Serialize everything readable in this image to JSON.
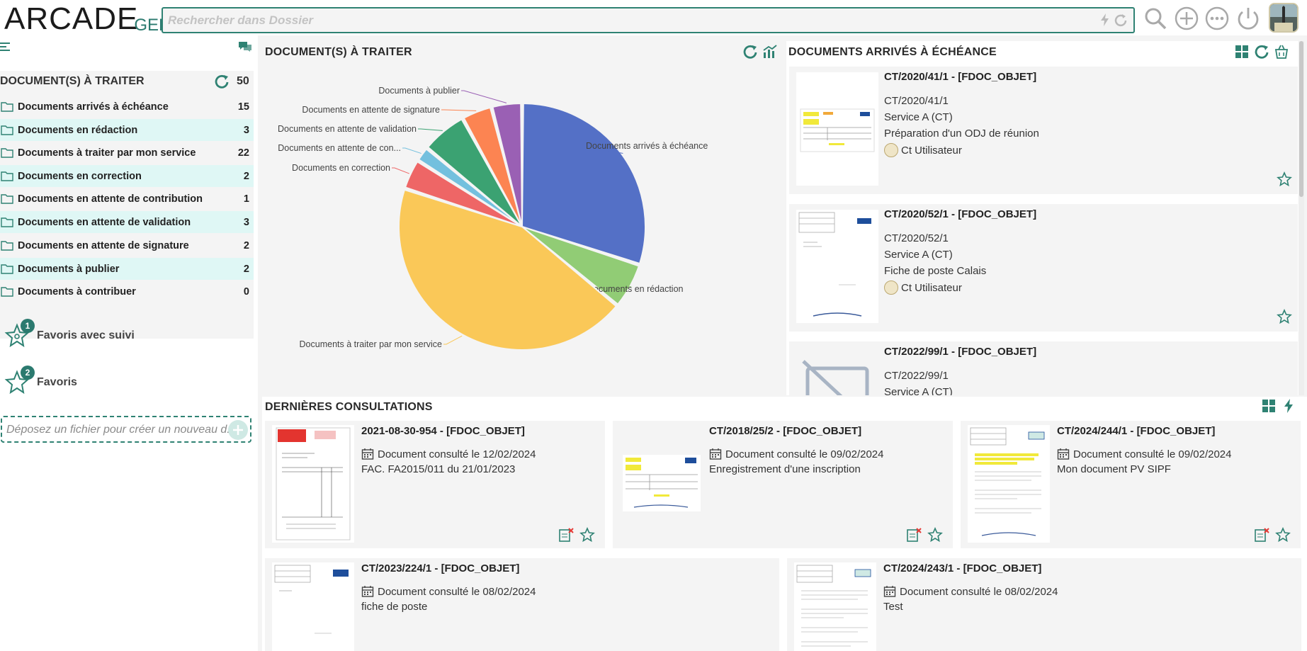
{
  "header": {
    "logo_main": "ARCADE",
    "logo_sub": "GED",
    "search_placeholder": "Rechercher dans Dossier",
    "icons": [
      "search-icon",
      "add-icon",
      "more-icon",
      "power-icon",
      "user-avatar"
    ]
  },
  "sidebar": {
    "queue": {
      "title": "DOCUMENT(S) À TRAITER",
      "total": "50",
      "items": [
        {
          "label": "Documents arrivés à échéance",
          "count": "15"
        },
        {
          "label": "Documents en rédaction",
          "count": "3"
        },
        {
          "label": "Documents à traiter par mon service",
          "count": "22"
        },
        {
          "label": "Documents en correction",
          "count": "2"
        },
        {
          "label": "Documents en attente de contribution",
          "count": "1"
        },
        {
          "label": "Documents en attente de validation",
          "count": "3"
        },
        {
          "label": "Documents en attente de signature",
          "count": "2"
        },
        {
          "label": "Documents à publier",
          "count": "2"
        },
        {
          "label": "Documents à contribuer",
          "count": "0"
        }
      ]
    },
    "favorites_followed": {
      "label": "Favoris avec suivi",
      "badge": "1"
    },
    "favorites": {
      "label": "Favoris",
      "badge": "2"
    },
    "dropzone": {
      "text": "Déposez un fichier pour créer un nouveau d..."
    }
  },
  "chart_panel": {
    "title": "DOCUMENT(S) À TRAITER"
  },
  "chart_data": {
    "type": "pie",
    "title": "",
    "categories": [
      "Documents arrivés à échéance",
      "Documents en rédaction",
      "Documents à traiter par mon service",
      "Documents en correction",
      "Documents en attente de con...",
      "Documents en attente de validation",
      "Documents en attente de signature",
      "Documents à publier"
    ],
    "values": [
      15,
      3,
      22,
      2,
      1,
      3,
      2,
      2
    ],
    "colors": [
      "#5470c6",
      "#91cc75",
      "#fac858",
      "#ee6666",
      "#73c0de",
      "#3ba272",
      "#fc8452",
      "#9a60b4"
    ]
  },
  "due_panel": {
    "title": "DOCUMENTS ARRIVÉS À ÉCHÉANCE",
    "cards": [
      {
        "title": "CT/2020/41/1 - [FDOC_OBJET]",
        "ref": "CT/2020/41/1",
        "service": "Service A (CT)",
        "desc": "Préparation d'un ODJ de réunion",
        "user": "Ct Utilisateur"
      },
      {
        "title": "CT/2020/52/1 - [FDOC_OBJET]",
        "ref": "CT/2020/52/1",
        "service": "Service A (CT)",
        "desc": "Fiche de poste Calais",
        "user": "Ct Utilisateur"
      },
      {
        "title": "CT/2022/99/1 - [FDOC_OBJET]",
        "ref": "CT/2022/99/1",
        "service": "Service A (CT)",
        "desc": "",
        "user": ""
      }
    ]
  },
  "recent_panel": {
    "title": "DERNIÈRES CONSULTATIONS",
    "cards": [
      {
        "title": "2021-08-30-954 - [FDOC_OBJET]",
        "date": "Document consulté le 12/02/2024",
        "desc": "FAC. FA2015/011 du 21/01/2023"
      },
      {
        "title": "CT/2018/25/2 - [FDOC_OBJET]",
        "date": "Document consulté le 09/02/2024",
        "desc": "Enregistrement d'une inscription"
      },
      {
        "title": "CT/2024/244/1 - [FDOC_OBJET]",
        "date": "Document consulté le 09/02/2024",
        "desc": "Mon document PV SIPF"
      },
      {
        "title": "CT/2023/224/1 - [FDOC_OBJET]",
        "date": "Document consulté le 08/02/2024",
        "desc": "fiche de poste"
      },
      {
        "title": "CT/2024/243/1 - [FDOC_OBJET]",
        "date": "Document consulté le 08/02/2024",
        "desc": "Test"
      }
    ]
  },
  "colors": {
    "accent": "#2f8273",
    "row_highlight": "#dff7f5"
  }
}
